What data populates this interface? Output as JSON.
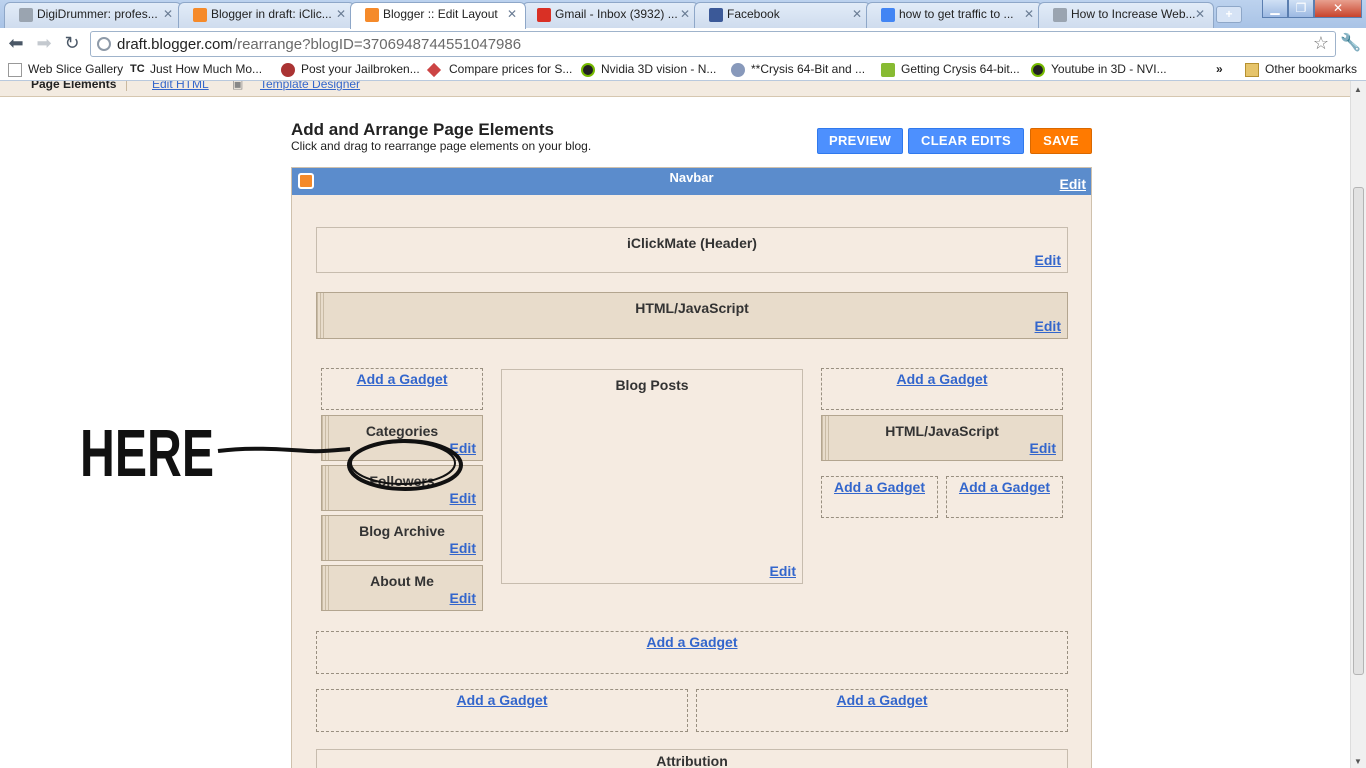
{
  "browser": {
    "tabs": [
      {
        "title": "DigiDrummer: profes...",
        "icon_color": "#9aa4b0"
      },
      {
        "title": "Blogger in draft: iClic...",
        "icon_color": "#f58a2a"
      },
      {
        "title": "Blogger :: Edit Layout",
        "icon_color": "#f58a2a"
      },
      {
        "title": "Gmail - Inbox (3932) ...",
        "icon_color": "#d93025"
      },
      {
        "title": "Facebook",
        "icon_color": "#3b5998"
      },
      {
        "title": "how to get traffic to ...",
        "icon_color": "#4285f4"
      },
      {
        "title": "How to Increase Web...",
        "icon_color": "#9aa4b0"
      }
    ],
    "url_host": "draft.blogger.com",
    "url_path": "/rearrange?blogID=3706948744551047986",
    "bookmarks": [
      {
        "label": "Web Slice Gallery",
        "icon": "page-icon"
      },
      {
        "label": "Just How Much Mo...",
        "icon": "tc-icon"
      },
      {
        "label": "Post your Jailbroken...",
        "icon": "jailbreak-icon"
      },
      {
        "label": "Compare prices for S...",
        "icon": "tag-icon"
      },
      {
        "label": "Nvidia 3D vision - N...",
        "icon": "nvidia-icon"
      },
      {
        "label": "**Crysis 64-Bit and ...",
        "icon": "crysis-icon"
      },
      {
        "label": "Getting Crysis 64-bit...",
        "icon": "chat-icon"
      },
      {
        "label": "Youtube in 3D - NVI...",
        "icon": "nvidia-icon"
      }
    ],
    "other_bookmarks": "Other bookmarks"
  },
  "blogger": {
    "page_tabs": [
      "Page Elements",
      "Edit HTML",
      "Template Designer"
    ],
    "heading": "Add and Arrange Page Elements",
    "subheading": "Click and drag to rearrange page elements on your blog.",
    "buttons": {
      "preview": "PREVIEW",
      "clear": "CLEAR EDITS",
      "save": "SAVE"
    },
    "colors": {
      "preview": "#4d90fe",
      "clear": "#4d90fe",
      "save": "#ff7a00",
      "navbar": "#5b8ccc"
    },
    "navbar": {
      "title": "Navbar",
      "edit": "Edit"
    },
    "header": {
      "title": "iClickMate (Header)",
      "edit": "Edit"
    },
    "html_wide": {
      "title": "HTML/JavaScript",
      "edit": "Edit"
    },
    "add_gadget": "Add a Gadget",
    "edit": "Edit",
    "left_sidebar": [
      "Categories",
      "Followers",
      "Blog Archive",
      "About Me"
    ],
    "main": {
      "title": "Blog Posts",
      "edit": "Edit"
    },
    "right_sidebar": {
      "title": "HTML/JavaScript",
      "edit": "Edit"
    },
    "attribution": "Attribution",
    "annotation": "HERE"
  }
}
